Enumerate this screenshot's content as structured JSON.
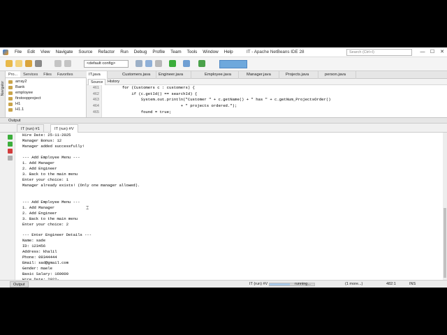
{
  "window": {
    "menus": [
      "File",
      "Edit",
      "View",
      "Navigate",
      "Source",
      "Refactor",
      "Run",
      "Debug",
      "Profile",
      "Team",
      "Tools",
      "Window",
      "Help"
    ],
    "title": "IT - Apache NetBeans IDE 28",
    "search_placeholder": "Search (Ctrl+I)",
    "controls": {
      "minimize": "—",
      "maximize": "☐",
      "close": "✕"
    }
  },
  "toolbar": {
    "config": "<default config>"
  },
  "navigator_label": "Navigator",
  "projects_panel": {
    "tabs": [
      "Pro...",
      "Services",
      "Files",
      "Favorites"
    ],
    "tree": [
      "array2",
      "Bank",
      "employee",
      "firstoopproject",
      "H1",
      "H1.1"
    ]
  },
  "editor": {
    "tabs": [
      "IT.java",
      "Customers.java",
      "Engineer.java",
      "Employee.java",
      "Manager.java",
      "Projects.java",
      "person.java"
    ],
    "view_tabs": {
      "source": "Source",
      "history": "History"
    },
    "line_numbers": [
      "461",
      "462",
      "463",
      "464",
      "465"
    ],
    "code_lines": [
      "        for (Customers c : customers) {",
      "            if (c.getId() == searchId) {",
      "                System.out.println(\"Customer \" + c.getName() + \" has \" + c.getNum_ProjectsOrder()",
      "                                 + \" projects ordered.\");",
      "                found = true;"
    ]
  },
  "output": {
    "header": "Output",
    "tabs": [
      "IT (run) #1",
      "IT (run) #V"
    ],
    "lines": [
      "Hire Date: 25-11-2025",
      "Manager Bonus: 12",
      "Manager added successfully!",
      "",
      "--- Add Employee Menu ---",
      "1. Add Manager",
      "2. Add Engineer",
      "3. Back to the main menu",
      "Enter your choice: 1",
      "Manager already exists! (Only one manager allowed).",
      "",
      "",
      "--- Add Employee Menu ---",
      "1. Add Manager",
      "2. Add Engineer",
      "3. Back to the main menu",
      "Enter your choice: 2",
      "",
      "--- Enter Engineer Details ---",
      "Name: sade",
      "ID: 123456",
      "Address: khalil",
      "Phone: 09344444",
      "Email: sad@gmail.com",
      "Gender: maele",
      "Basic Salary: 160000",
      "Hire Date: 2022-"
    ]
  },
  "status": {
    "output_tab": "Output",
    "run_name": "IT (run) #V",
    "state": "running...",
    "more": "(1 more...)",
    "position": "482:1",
    "mode": "INS",
    "progress": 0.45
  }
}
